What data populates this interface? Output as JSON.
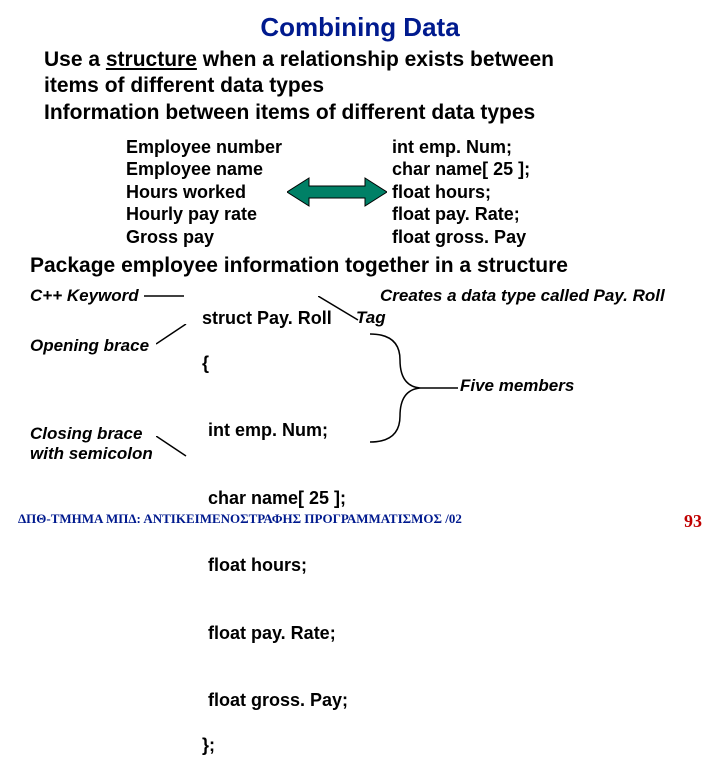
{
  "title": "Combining Data",
  "intro": {
    "l1a": "Use a ",
    "l1b": "structure",
    "l1c": " when a relationship exists between",
    "l2": "items of different data types",
    "l3": "Information between items of different data types"
  },
  "left": {
    "r1": "Employee number",
    "r2": "Employee name",
    "r3": "Hours worked",
    "r4": "Hourly pay rate",
    "r5": "Gross pay"
  },
  "right": {
    "r1": "int emp. Num;",
    "r2": "char name[ 25 ];",
    "r3": "float hours;",
    "r4": "float pay. Rate;",
    "r5": "float gross. Pay"
  },
  "package": "Package employee information together in a structure",
  "struct": {
    "s1": "struct Pay. Roll",
    "s2": "{",
    "m1": "int emp. Num;",
    "m2": "char name[ 25 ];",
    "m3": "float hours;",
    "m4": "float pay. Rate;",
    "m5": "float gross. Pay;",
    "s3": "};"
  },
  "ann": {
    "keyword": "C++ Keyword",
    "creates": "Creates a data type called Pay. Roll",
    "tag": "Tag",
    "open": "Opening brace",
    "five": "Five members",
    "close1": "Closing brace",
    "close2": "with semicolon"
  },
  "footer": {
    "text": "ΔΠΘ-ΤΜΗΜΑ ΜΠΔ: ΑΝΤΙΚΕΙΜΕΝΟΣΤΡΑΦΗΣ ΠΡΟΓΡΑΜΜΑΤΙΣΜΟΣ /02",
    "page": "93"
  }
}
